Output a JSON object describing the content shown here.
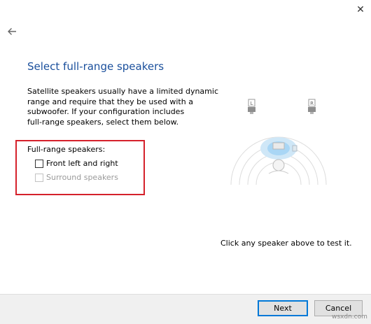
{
  "window": {
    "close_glyph": "✕"
  },
  "page": {
    "title": "Select full-range speakers",
    "description_lines": [
      "Satellite speakers usually have a limited dynamic",
      "range and require that they be used with a",
      "subwoofer.  If your configuration includes",
      "full-range speakers, select them below."
    ],
    "group_label": "Full-range speakers:",
    "options": [
      {
        "label": "Front left and right",
        "checked": false,
        "enabled": true
      },
      {
        "label": "Surround speakers",
        "checked": false,
        "enabled": false
      }
    ],
    "diagram": {
      "left_label": "L",
      "right_label": "R"
    },
    "hint": "Click any speaker above to test it."
  },
  "footer": {
    "next_label": "Next",
    "cancel_label": "Cancel"
  },
  "watermark": "wsxdn.com",
  "colors": {
    "title": "#1a4f9c",
    "highlight_box": "#d5212b",
    "accent": "#0078d7"
  }
}
